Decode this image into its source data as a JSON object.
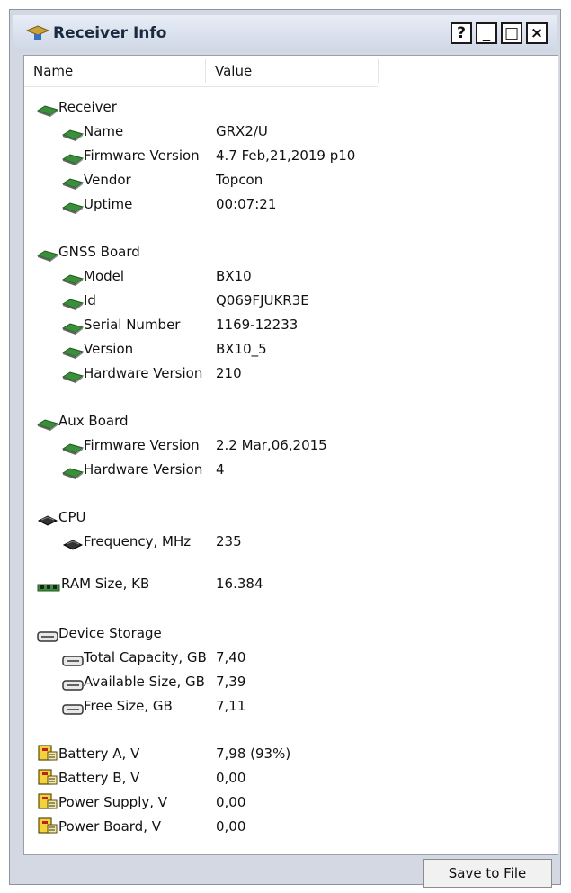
{
  "window": {
    "title": "Receiver Info",
    "help_btn": "?",
    "min_btn": "_",
    "max_btn": "□",
    "close_btn": "×"
  },
  "columns": {
    "name": "Name",
    "value": "Value"
  },
  "groups": {
    "receiver": {
      "label": "Receiver",
      "items": [
        {
          "name": "Name",
          "value": "GRX2/U"
        },
        {
          "name": "Firmware Version",
          "value": "4.7 Feb,21,2019 p10"
        },
        {
          "name": "Vendor",
          "value": "Topcon"
        },
        {
          "name": "Uptime",
          "value": "00:07:21"
        }
      ]
    },
    "gnss": {
      "label": "GNSS Board",
      "items": [
        {
          "name": "Model",
          "value": "BX10"
        },
        {
          "name": "Id",
          "value": "Q069FJUKR3E"
        },
        {
          "name": "Serial Number",
          "value": "1169-12233"
        },
        {
          "name": "Version",
          "value": "BX10_5"
        },
        {
          "name": "Hardware Version",
          "value": "210"
        }
      ]
    },
    "aux": {
      "label": "Aux Board",
      "items": [
        {
          "name": "Firmware Version",
          "value": "2.2 Mar,06,2015"
        },
        {
          "name": "Hardware Version",
          "value": "4"
        }
      ]
    },
    "cpu": {
      "label": "CPU",
      "items": [
        {
          "name": "Frequency, MHz",
          "value": "235"
        }
      ]
    },
    "ram": {
      "label": "RAM Size, KB",
      "value": "16.384"
    },
    "storage": {
      "label": "Device Storage",
      "items": [
        {
          "name": "Total Capacity, GB",
          "value": "7,40"
        },
        {
          "name": "Available Size, GB",
          "value": "7,39"
        },
        {
          "name": "Free Size, GB",
          "value": "7,11"
        }
      ]
    },
    "power": [
      {
        "name": "Battery A, V",
        "value": "7,98 (93%)"
      },
      {
        "name": "Battery B, V",
        "value": "0,00"
      },
      {
        "name": "Power Supply, V",
        "value": "0,00"
      },
      {
        "name": "Power Board, V",
        "value": "0,00"
      }
    ]
  },
  "footer": {
    "save_label": "Save to File"
  },
  "colors": {
    "board_green": "#3a8f3a",
    "titlebar": "#dbe2ef",
    "accent": "#1a2a40"
  },
  "icons": {
    "board": "circuit-board-icon",
    "cpu": "cpu-icon",
    "ram": "memory-icon",
    "storage": "storage-icon",
    "battery": "battery-icon"
  }
}
